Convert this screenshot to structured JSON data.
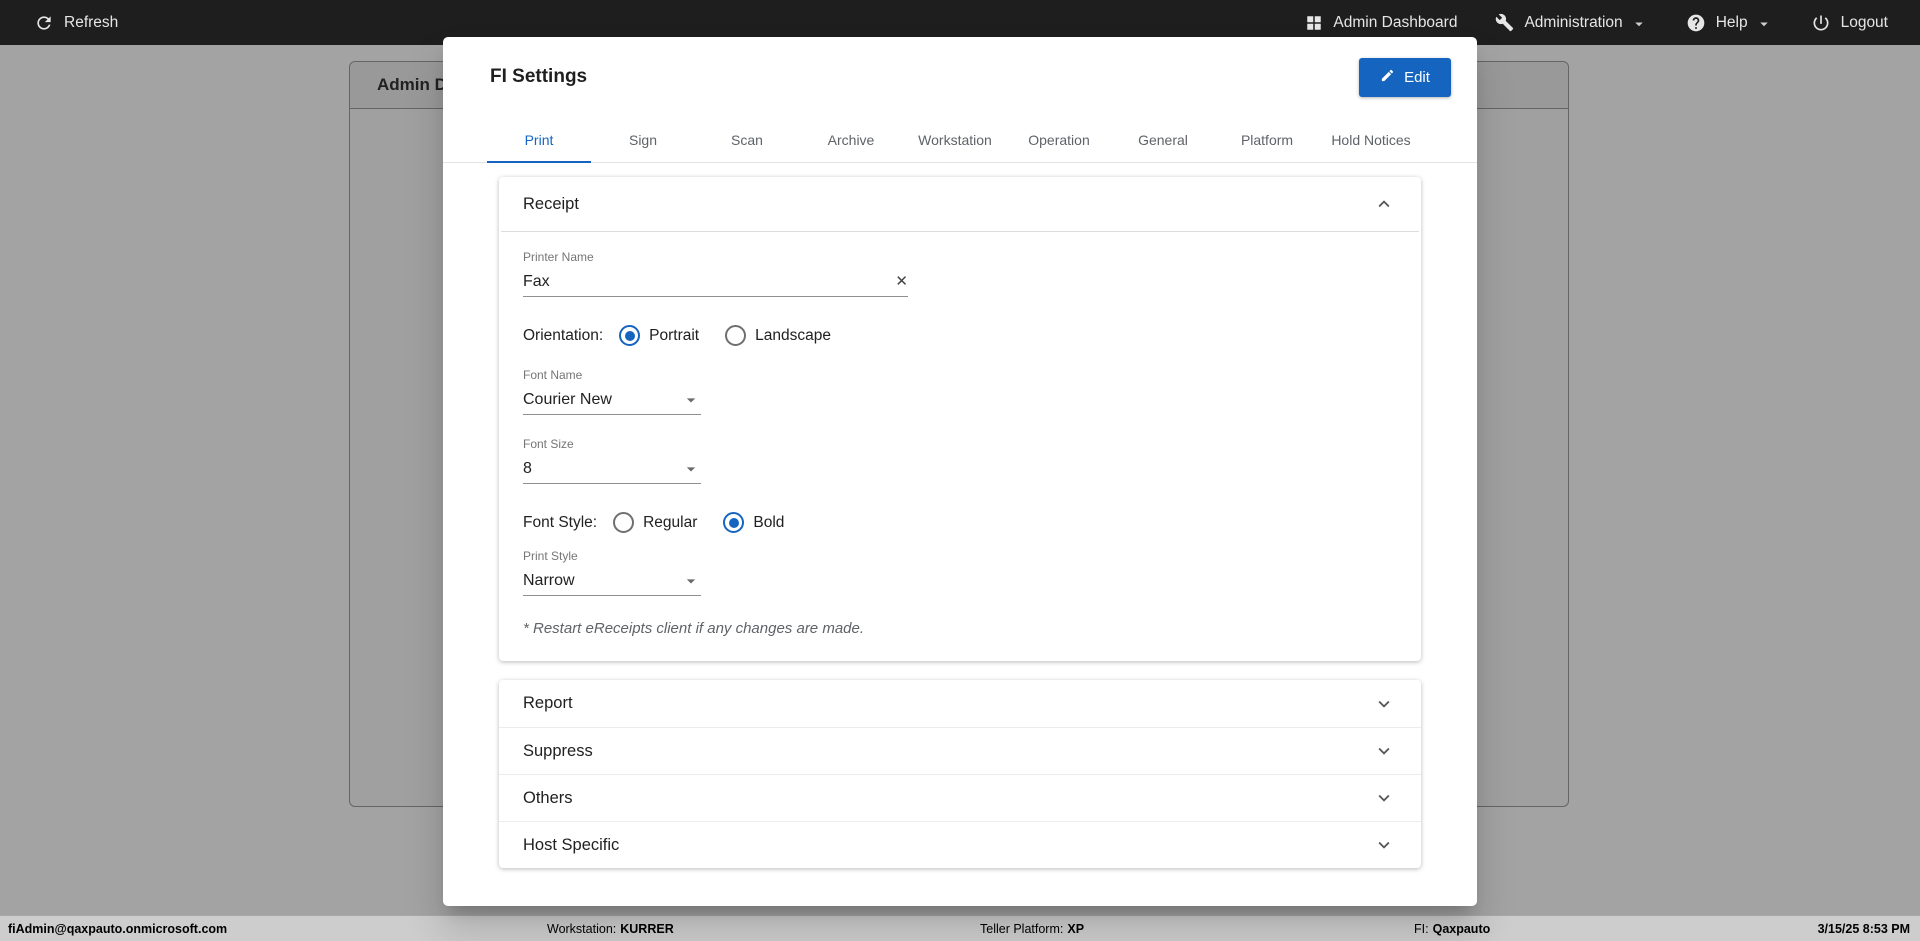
{
  "topbar": {
    "refresh": "Refresh",
    "admin_dashboard": "Admin Dashboard",
    "administration": "Administration",
    "help": "Help",
    "logout": "Logout"
  },
  "background_page": {
    "header": "Admin D"
  },
  "modal": {
    "title": "FI Settings",
    "edit_button": "Edit",
    "tabs": [
      {
        "label": "Print",
        "active": true
      },
      {
        "label": "Sign"
      },
      {
        "label": "Scan"
      },
      {
        "label": "Archive"
      },
      {
        "label": "Workstation"
      },
      {
        "label": "Operation"
      },
      {
        "label": "General"
      },
      {
        "label": "Platform"
      },
      {
        "label": "Hold Notices"
      }
    ],
    "receipt_panel": {
      "title": "Receipt",
      "printer_name": {
        "label": "Printer Name",
        "value": "Fax"
      },
      "orientation": {
        "label": "Orientation:",
        "options": [
          "Portrait",
          "Landscape"
        ],
        "selected": "Portrait"
      },
      "font_name": {
        "label": "Font Name",
        "value": "Courier New"
      },
      "font_size": {
        "label": "Font Size",
        "value": "8"
      },
      "font_style": {
        "label": "Font Style:",
        "options": [
          "Regular",
          "Bold"
        ],
        "selected": "Bold"
      },
      "print_style": {
        "label": "Print Style",
        "value": "Narrow"
      },
      "note": "* Restart eReceipts client if any changes are made."
    },
    "collapsed_panels": [
      "Report",
      "Suppress",
      "Others",
      "Host Specific"
    ]
  },
  "statusbar": {
    "user": "fiAdmin@qaxpauto.onmicrosoft.com",
    "workstation_label": "Workstation:",
    "workstation_value": "KURRER",
    "platform_label": "Teller Platform:",
    "platform_value": "XP",
    "fi_label": "FI:",
    "fi_value": "Qaxpauto",
    "datetime": "3/15/25 8:53 PM"
  },
  "colors": {
    "accent": "#1565c0",
    "topbar_bg": "#1e1e1e",
    "statusbar_bg": "#cdcdcd"
  }
}
